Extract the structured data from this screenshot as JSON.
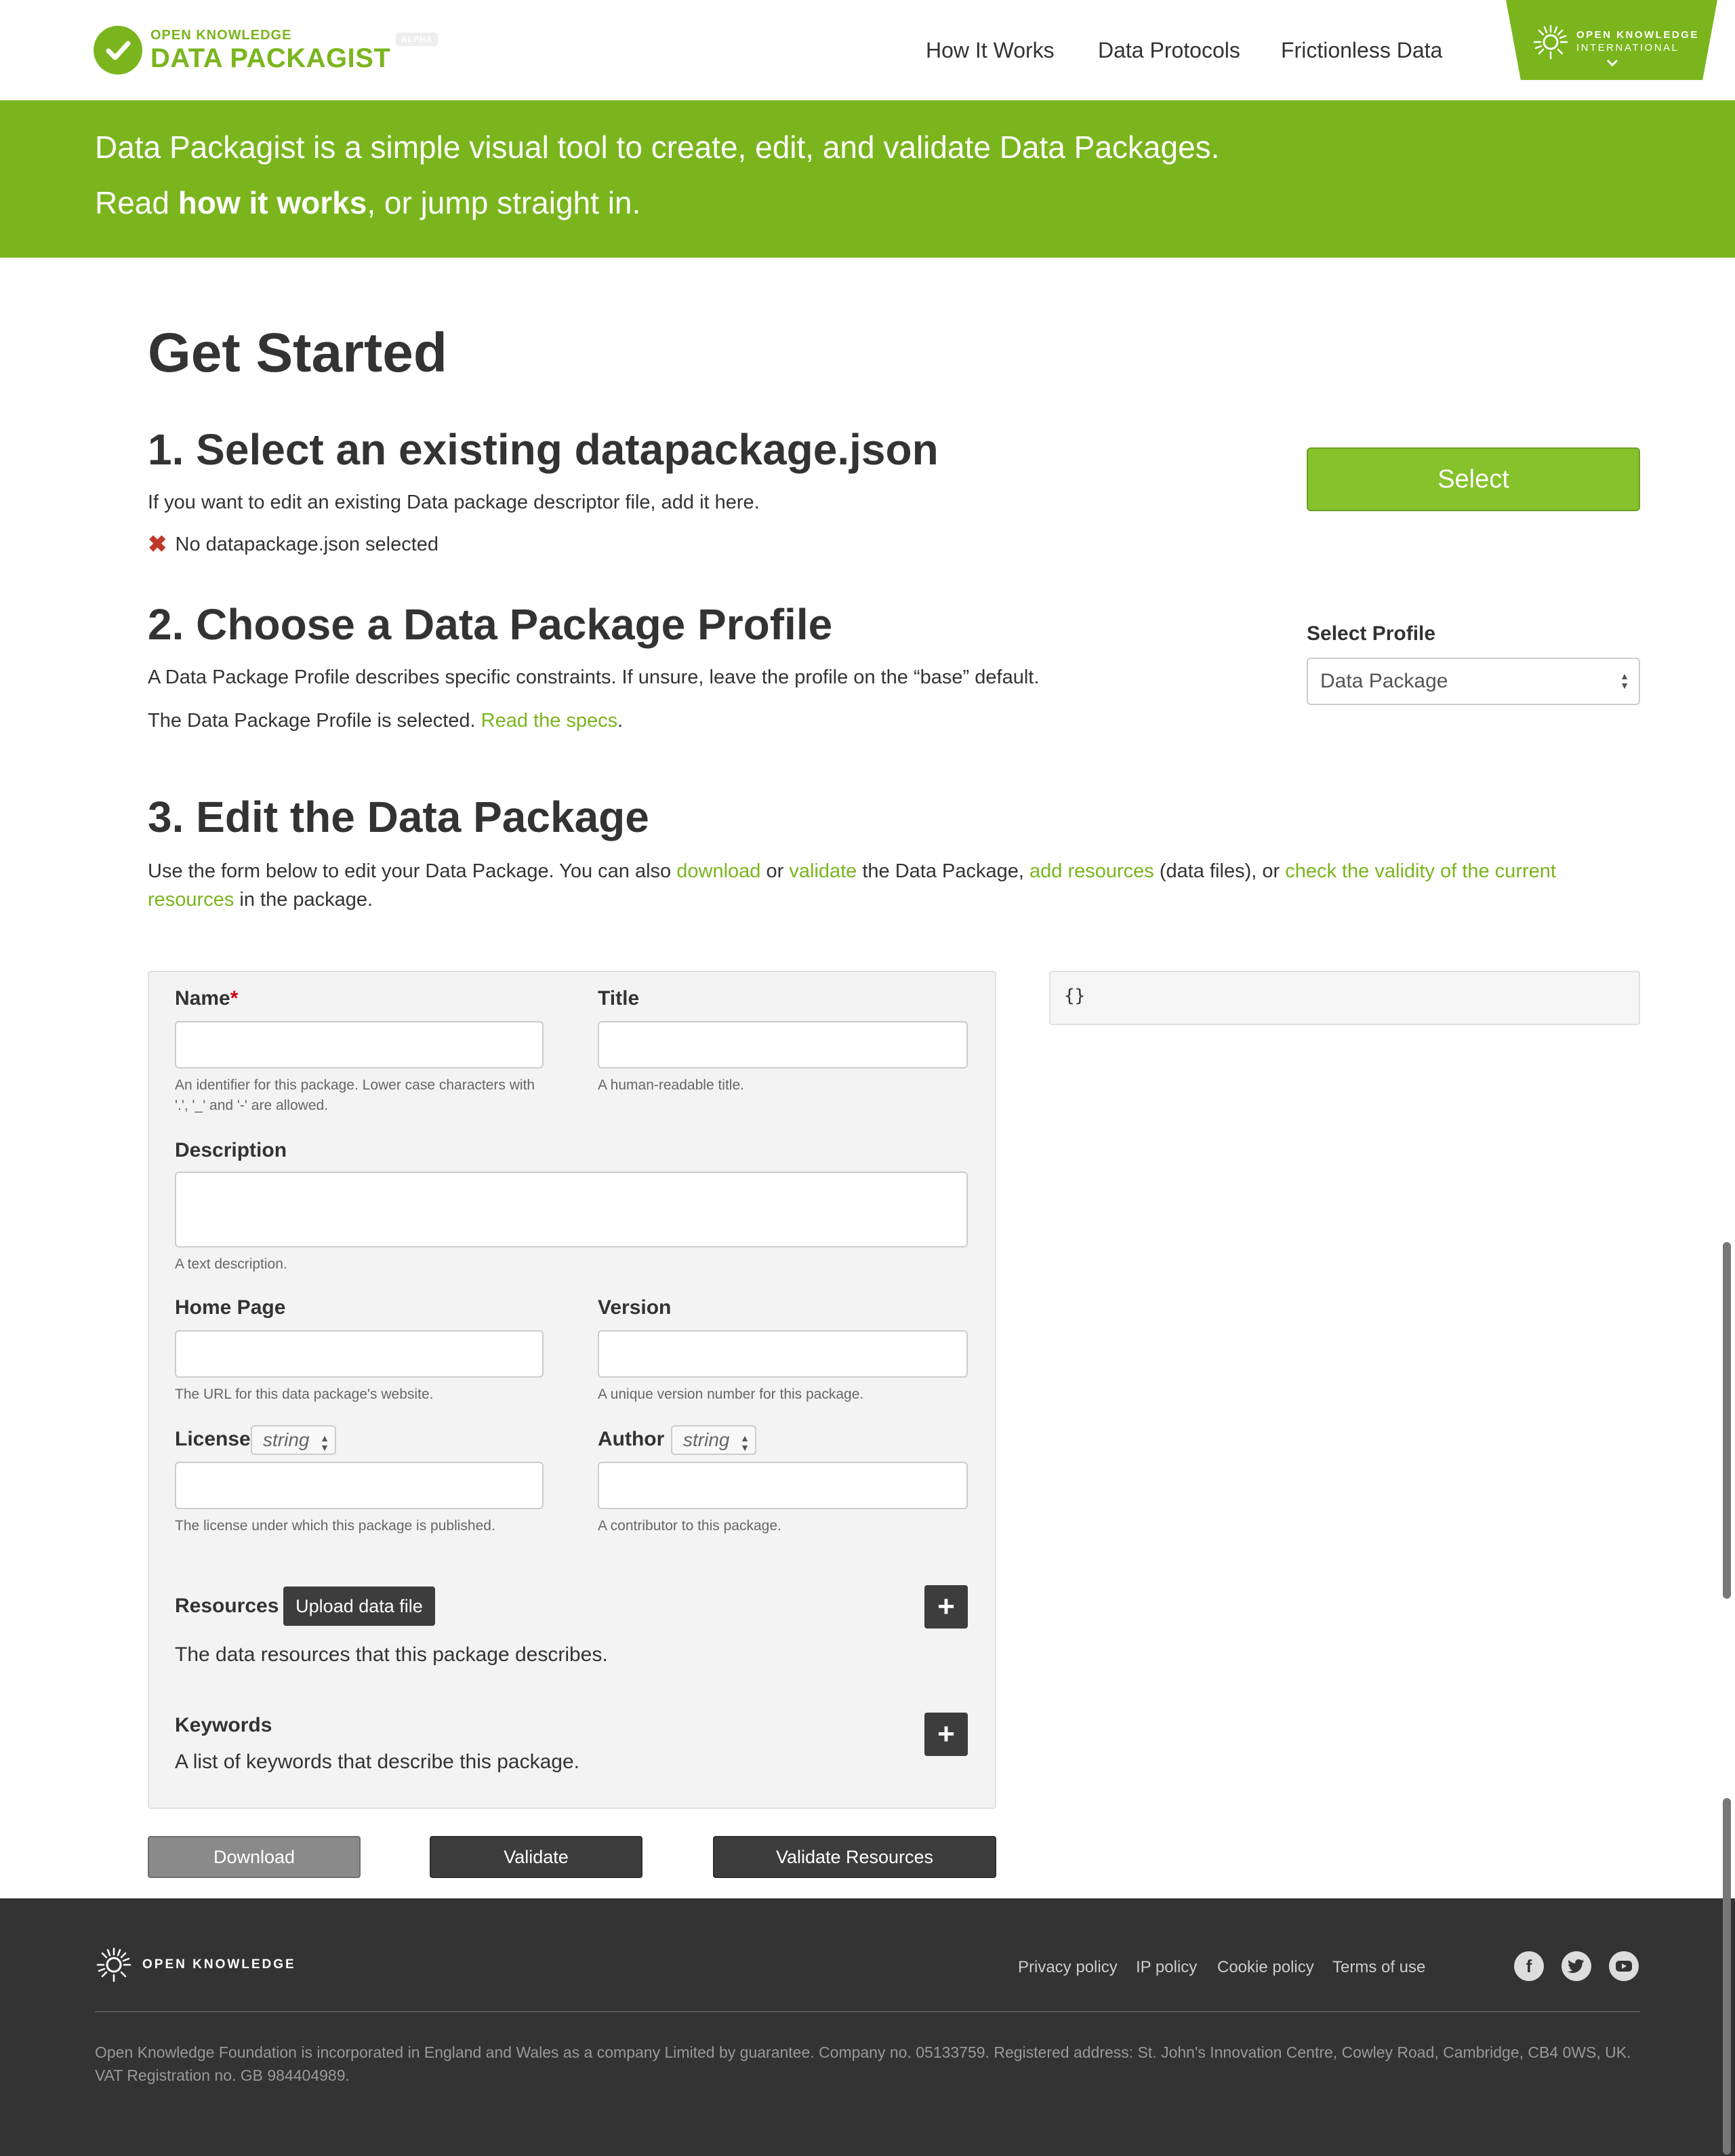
{
  "header": {
    "logo_top": "OPEN KNOWLEDGE",
    "logo_main": "DATA PACKAGIST",
    "badge": "ALPHA",
    "nav": [
      "How It Works",
      "Data Protocols",
      "Frictionless Data"
    ],
    "oki_line1": "OPEN KNOWLEDGE",
    "oki_line2": "INTERNATIONAL"
  },
  "banner": {
    "line1": "Data Packagist is a simple visual tool to create, edit, and validate Data Packages.",
    "line2_pre": "Read ",
    "line2_link": "how it works",
    "line2_post": ", or jump straight in."
  },
  "main": {
    "title": "Get Started",
    "step1": {
      "heading": "1. Select an existing datapackage.json",
      "desc": "If you want to edit an existing Data package descriptor file, add it here.",
      "status": "No datapackage.json selected",
      "button": "Select"
    },
    "step2": {
      "heading": "2. Choose a Data Package Profile",
      "desc": "A Data Package Profile describes specific constraints. If unsure, leave the profile on the “base” default.",
      "selected_text": "The Data Package Profile is selected. ",
      "spec_link": "Read the specs",
      "period": ".",
      "profile_label": "Select Profile",
      "profile_value": "Data Package"
    },
    "step3": {
      "heading": "3. Edit the Data Package",
      "d1": "Use the form below to edit your Data Package. You can also ",
      "l_download": "download",
      "d2": " or ",
      "l_validate": "validate",
      "d3": " the Data Package, ",
      "l_add": "add resources",
      "d4": " (data files), or ",
      "l_check1": "check the validity of the current",
      "l_check2": "resources",
      "d5": " in the package."
    }
  },
  "form": {
    "name_label": "Name",
    "name_req": "*",
    "name_help1": "An identifier for this package. Lower case characters with",
    "name_help2": "'.', '_' and '-' are allowed.",
    "title_label": "Title",
    "title_help": "A human-readable title.",
    "description_label": "Description",
    "description_help": "A text description.",
    "homepage_label": "Home Page",
    "homepage_help": "The URL for this data package's website.",
    "version_label": "Version",
    "version_help": "A unique version number for this package.",
    "license_label": "License",
    "license_type": "string",
    "license_help": "The license under which this package is published.",
    "author_label": "Author",
    "author_type": "string",
    "author_help": "A contributor to this package.",
    "resources_label": "Resources",
    "upload_button": "Upload data file",
    "resources_desc": "The data resources that this package describes.",
    "keywords_label": "Keywords",
    "keywords_desc": "A list of keywords that describe this package.",
    "plus": "+"
  },
  "json_preview": "{}",
  "actions": {
    "download": "Download",
    "validate": "Validate",
    "validate_resources": "Validate Resources"
  },
  "footer": {
    "logo": "OPEN KNOWLEDGE",
    "links": [
      "Privacy policy",
      "IP policy",
      "Cookie policy",
      "Terms of use"
    ],
    "social": [
      "facebook-icon",
      "twitter-icon",
      "youtube-icon"
    ],
    "legal1": "Open Knowledge Foundation is incorporated in England and Wales as a company Limited by guarantee. Company no. 05133759. Registered address: St. John's Innovation Centre, Cowley Road, Cambridge, CB4 0WS, UK.",
    "legal2": "VAT Registration no. GB 984404989."
  },
  "colors": {
    "brand_green": "#7ab51d",
    "button_green": "#85c22b",
    "dark_button": "#3d3d3d",
    "footer_bg": "#333333",
    "error_red": "#c0392b"
  }
}
